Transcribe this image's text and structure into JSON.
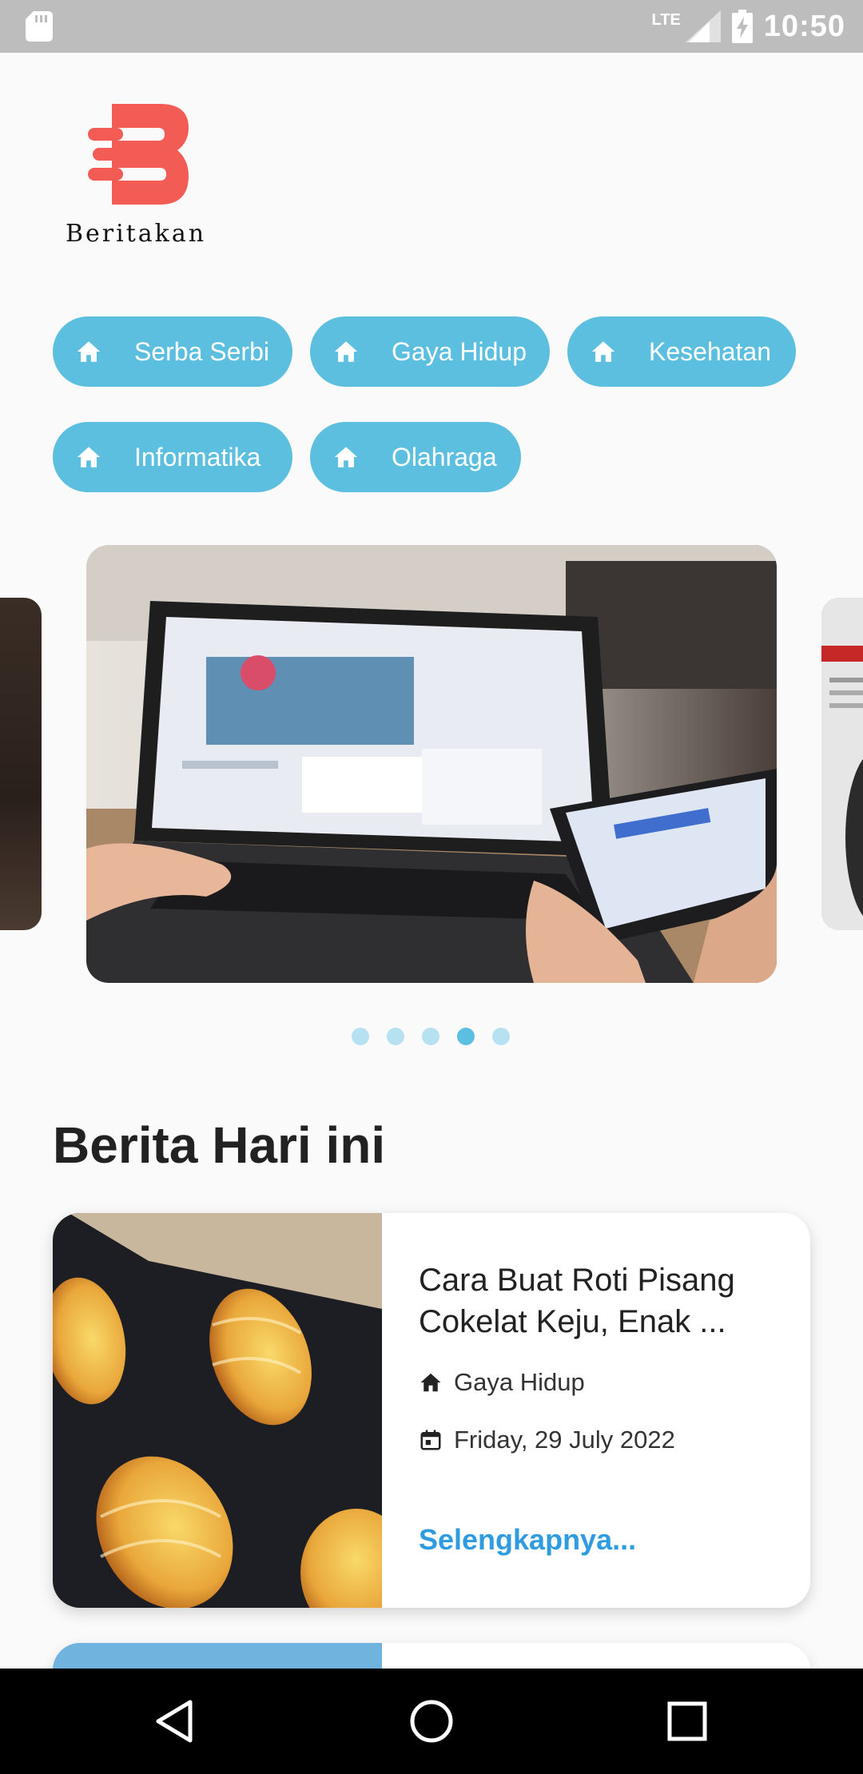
{
  "status_bar": {
    "network": "LTE",
    "time": "10:50"
  },
  "app": {
    "logo_text": "Beritakan",
    "brand_color": "#f25c54",
    "accent_color": "#5cbfe0",
    "link_color": "#2f9be0"
  },
  "categories": [
    {
      "label": "Serba Serbi",
      "icon": "home-icon"
    },
    {
      "label": "Gaya Hidup",
      "icon": "home-icon"
    },
    {
      "label": "Kesehatan",
      "icon": "home-icon"
    },
    {
      "label": "Informatika",
      "icon": "home-icon"
    },
    {
      "label": "Olahraga",
      "icon": "home-icon"
    }
  ],
  "carousel": {
    "page_count": 5,
    "active_index": 3
  },
  "section": {
    "title": "Berita Hari ini"
  },
  "news": [
    {
      "title": "Cara Buat Roti Pisang Cokelat Keju, Enak ...",
      "category": "Gaya Hidup",
      "date": "Friday, 29 July 2022",
      "more_label": "Selengkapnya..."
    }
  ]
}
